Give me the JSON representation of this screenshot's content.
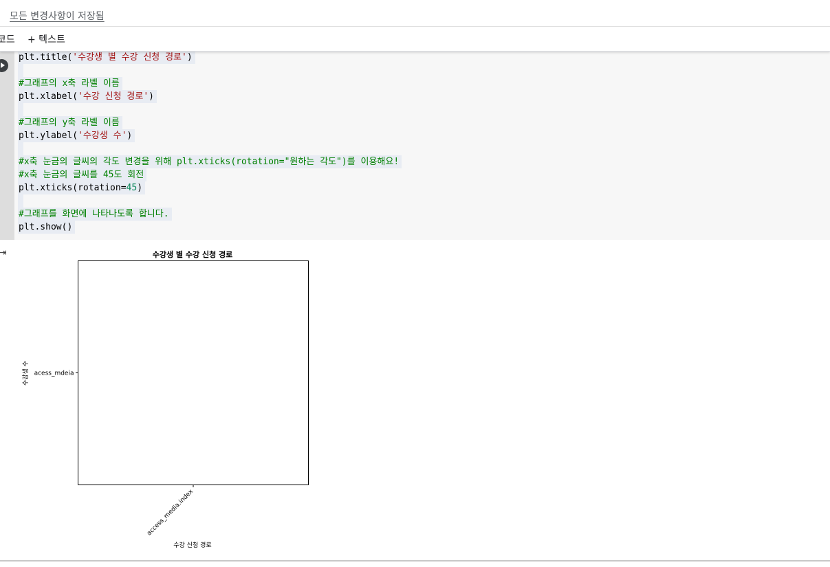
{
  "header": {
    "save_status": "모든 변경사항이 저장됨"
  },
  "toolbar": {
    "code_label": "코드",
    "add_text_label": "+ 텍스트"
  },
  "code_cell": {
    "lines": [
      {
        "segments": [
          {
            "text": "plt.title(",
            "cls": ""
          },
          {
            "text": "'수강생 별 수강 신청 경로'",
            "cls": "str"
          },
          {
            "text": ")",
            "cls": ""
          }
        ]
      },
      {
        "segments": []
      },
      {
        "segments": [
          {
            "text": "#그래프의 x축 라벨 이름",
            "cls": "cmt"
          }
        ]
      },
      {
        "segments": [
          {
            "text": "plt.xlabel(",
            "cls": ""
          },
          {
            "text": "'수강 신청 경로'",
            "cls": "str"
          },
          {
            "text": ")",
            "cls": ""
          }
        ]
      },
      {
        "segments": []
      },
      {
        "segments": [
          {
            "text": "#그래프의 y축 라벨 이름",
            "cls": "cmt"
          }
        ]
      },
      {
        "segments": [
          {
            "text": "plt.ylabel(",
            "cls": ""
          },
          {
            "text": "'수강생 수'",
            "cls": "str"
          },
          {
            "text": ")",
            "cls": ""
          }
        ]
      },
      {
        "segments": []
      },
      {
        "segments": [
          {
            "text": "#x축 눈금의 글씨의 각도 변경을 위해 plt.xticks(rotation=\"원하는 각도\")를 이용해요!",
            "cls": "cmt"
          }
        ]
      },
      {
        "segments": [
          {
            "text": "#x축 눈금의 글씨를 45도 회전",
            "cls": "cmt"
          }
        ]
      },
      {
        "segments": [
          {
            "text": "plt.xticks(rotation=",
            "cls": ""
          },
          {
            "text": "45",
            "cls": "num"
          },
          {
            "text": ")",
            "cls": ""
          }
        ]
      },
      {
        "segments": []
      },
      {
        "segments": [
          {
            "text": "#그래프를 화면에 나타나도록 합니다.",
            "cls": "cmt"
          }
        ]
      },
      {
        "segments": [
          {
            "text": "plt.show()",
            "cls": ""
          }
        ]
      }
    ]
  },
  "output": {
    "icon": "output-redirect-icon"
  },
  "chart_data": {
    "type": "bar",
    "title": "수강생 별 수강 신청 경로",
    "xlabel": "수강 신청 경로",
    "ylabel": "수강생 수",
    "categories": [
      "access_media.index"
    ],
    "y_categories": [
      "acess_mdeia"
    ],
    "values": [],
    "xtick_rotation": 45,
    "grid": false
  }
}
